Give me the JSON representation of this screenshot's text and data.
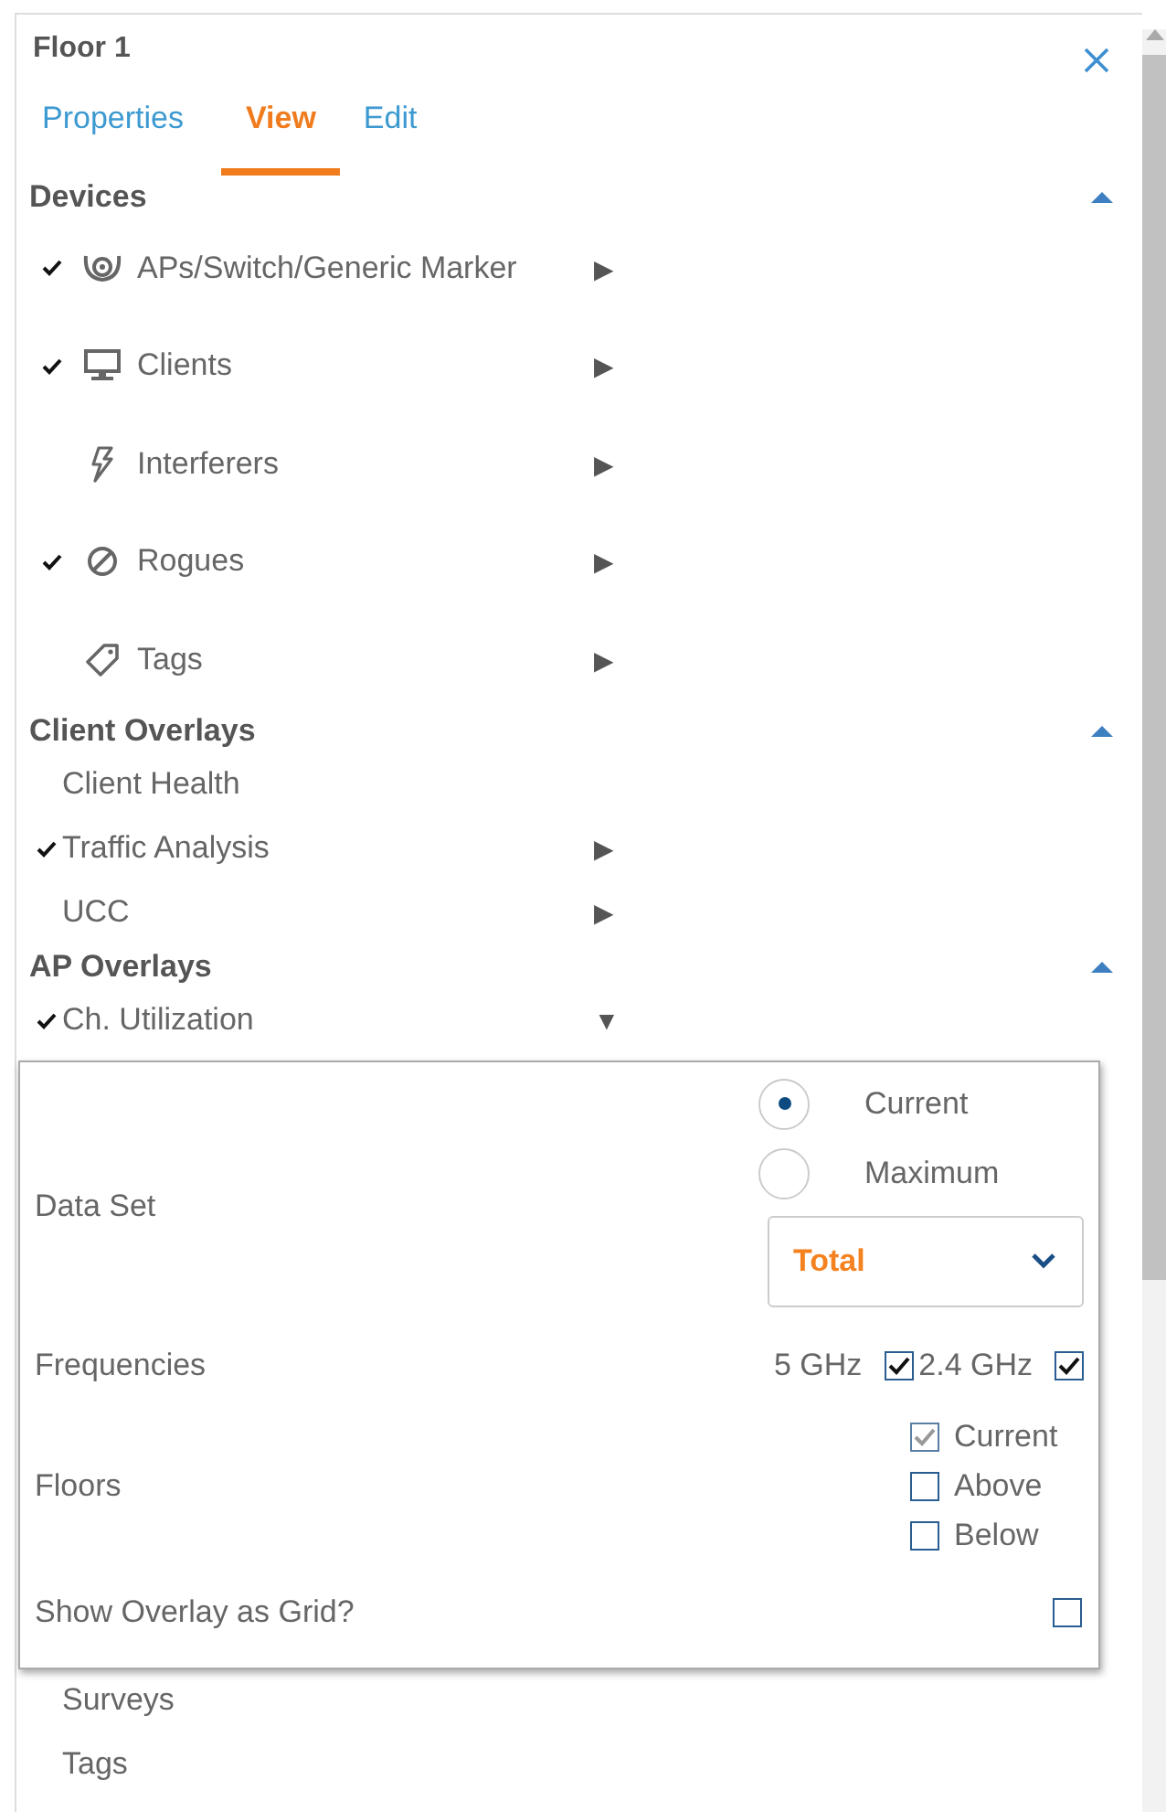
{
  "panel": {
    "title": "Floor 1"
  },
  "tabs": [
    {
      "label": "Properties",
      "selected": false
    },
    {
      "label": "View",
      "selected": true
    },
    {
      "label": "Edit",
      "selected": false
    }
  ],
  "sections": [
    {
      "title": "Devices",
      "expanded": true,
      "items": [
        {
          "label": "APs/Switch/Generic Marker",
          "kind": "ap",
          "checked": true,
          "arrow": "▶"
        },
        {
          "label": "Clients",
          "kind": "client",
          "checked": true,
          "arrow": "▶"
        },
        {
          "label": "Interferers",
          "kind": "interferer",
          "checked": false,
          "arrow": "▶"
        },
        {
          "label": "Rogues",
          "kind": "rogue",
          "checked": true,
          "arrow": "▶"
        },
        {
          "label": "Tags",
          "kind": "tag",
          "checked": false,
          "arrow": "▶"
        }
      ]
    },
    {
      "title": "Client Overlays",
      "expanded": true,
      "items": [
        {
          "label": "Client Health",
          "kind": "plain",
          "checked": false
        },
        {
          "label": "Traffic Analysis",
          "kind": "plain",
          "checked": true,
          "arrow": "▶"
        },
        {
          "label": "UCC",
          "kind": "plain",
          "checked": false,
          "arrow": "▶"
        }
      ]
    },
    {
      "title": "AP Overlays",
      "expanded": true,
      "items": [
        {
          "label": "Ch. Utilization",
          "kind": "plain",
          "checked": true,
          "arrow": "▼"
        }
      ]
    }
  ],
  "overlay_settings": {
    "data_set": {
      "label": "Data Set",
      "options": [
        {
          "label": "Current",
          "selected": true
        },
        {
          "label": "Maximum",
          "selected": false
        }
      ],
      "dropdown": "Total"
    },
    "frequencies": {
      "label": "Frequencies",
      "options": [
        {
          "label": "5 GHz",
          "checked": true
        },
        {
          "label": "2.4 GHz",
          "checked": true
        }
      ]
    },
    "floors": {
      "label": "Floors",
      "options": [
        {
          "label": "Current",
          "checked": true,
          "disabled": true
        },
        {
          "label": "Above",
          "checked": false,
          "disabled": false
        },
        {
          "label": "Below",
          "checked": false,
          "disabled": false
        }
      ]
    },
    "grid": {
      "label": "Show Overlay as Grid?",
      "checked": false
    }
  },
  "more_items": [
    {
      "label": "Surveys"
    },
    {
      "label": "Tags"
    }
  ]
}
